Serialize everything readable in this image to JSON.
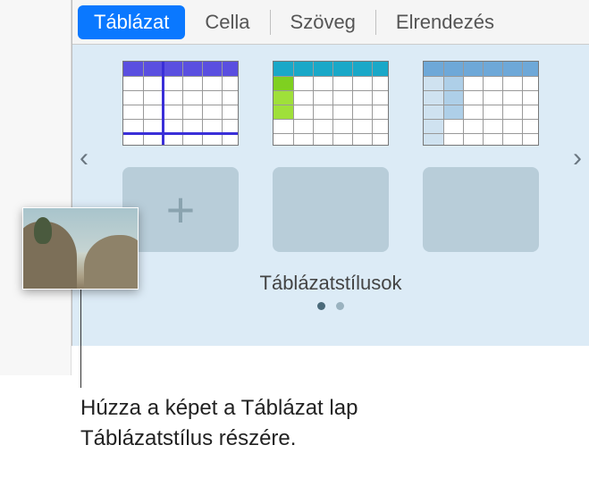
{
  "tabs": {
    "table": "Táblázat",
    "cell": "Cella",
    "text": "Szöveg",
    "layout": "Elrendezés"
  },
  "styles": {
    "label": "Táblázatstílusok",
    "items": [
      {
        "name": "style-purple",
        "accent": "#3a2fd8",
        "header": "#5a4fe0"
      },
      {
        "name": "style-green",
        "accent": "#8fd62a",
        "header": "#1aa8c8"
      },
      {
        "name": "style-blue",
        "accent": "#5e9fd4",
        "header": "#3b7fc0"
      }
    ],
    "arrows": {
      "left": "‹",
      "right": "›"
    },
    "plus": "+"
  },
  "caption": {
    "line1": "Húzza a képet a Táblázat lap",
    "line2": "Táblázatstílus részére."
  },
  "drag_image": {
    "alt": "beach-photo"
  }
}
